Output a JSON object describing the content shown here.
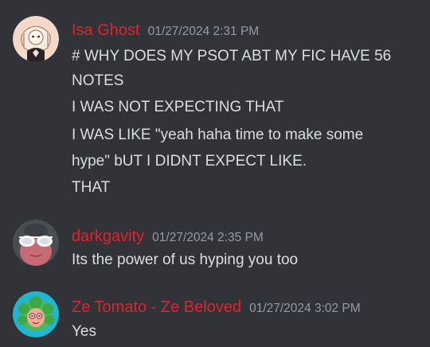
{
  "messages": [
    {
      "author": "Isa Ghost",
      "timestamp": "01/27/2024 2:31 PM",
      "lines": [
        "# WHY DOES MY PSOT ABT MY FIC HAVE 56",
        "NOTES",
        "I WAS NOT EXPECTING THAT",
        "I WAS LIKE \"yeah haha time to make some",
        "hype\" bUT I DIDNT EXPECT LIKE.",
        "THAT"
      ],
      "avatar_icon": "anime-girl-avatar-icon"
    },
    {
      "author": "darkgavity",
      "timestamp": "01/27/2024 2:35 PM",
      "lines": [
        "Its the power of us hyping you too"
      ],
      "avatar_icon": "sunglasses-avatar-icon"
    },
    {
      "author": "Ze Tomato - Ze Beloved",
      "timestamp": "01/27/2024 3:02 PM",
      "lines": [
        "Yes"
      ],
      "avatar_icon": "green-hair-avatar-icon"
    }
  ],
  "colors": {
    "background": "#313338",
    "username": "#e0242b",
    "timestamp": "#949ba4",
    "text": "#dbdee1"
  }
}
